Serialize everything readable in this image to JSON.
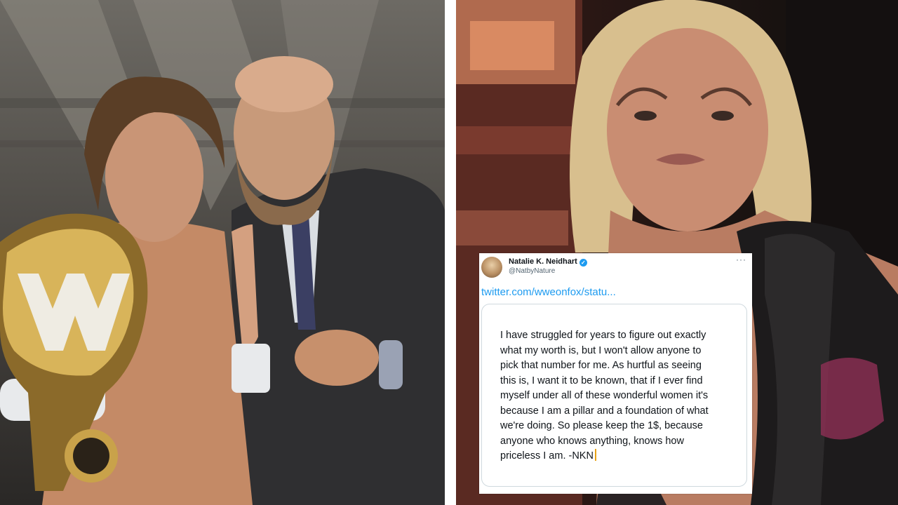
{
  "left_image": {
    "subject": "left-photo"
  },
  "right_image": {
    "subject": "right-photo"
  },
  "tweet": {
    "display_name": "Natalie K. Neidhart",
    "handle": "@NatbyNature",
    "more_icon": "ellipsis-icon",
    "verified_icon": "verified-badge-icon",
    "link_text": "twitter.com/wweonfox/statu...",
    "quote_lines": [
      "I have struggled for years to figure out exactly",
      "what my worth is, but I won't allow anyone to",
      "pick that number for me. As hurtful as seeing",
      "this is, I want it to be known, that if I ever find",
      "myself under all of these wonderful women it's",
      "because I am a pillar and a foundation of what",
      "we're doing. So please keep the 1$, because",
      "anyone who knows anything, knows how",
      "priceless I am. -NKN"
    ],
    "colors": {
      "link": "#1d9bf0",
      "verified": "#1d9bf0",
      "cursor": "#e8a317"
    }
  }
}
